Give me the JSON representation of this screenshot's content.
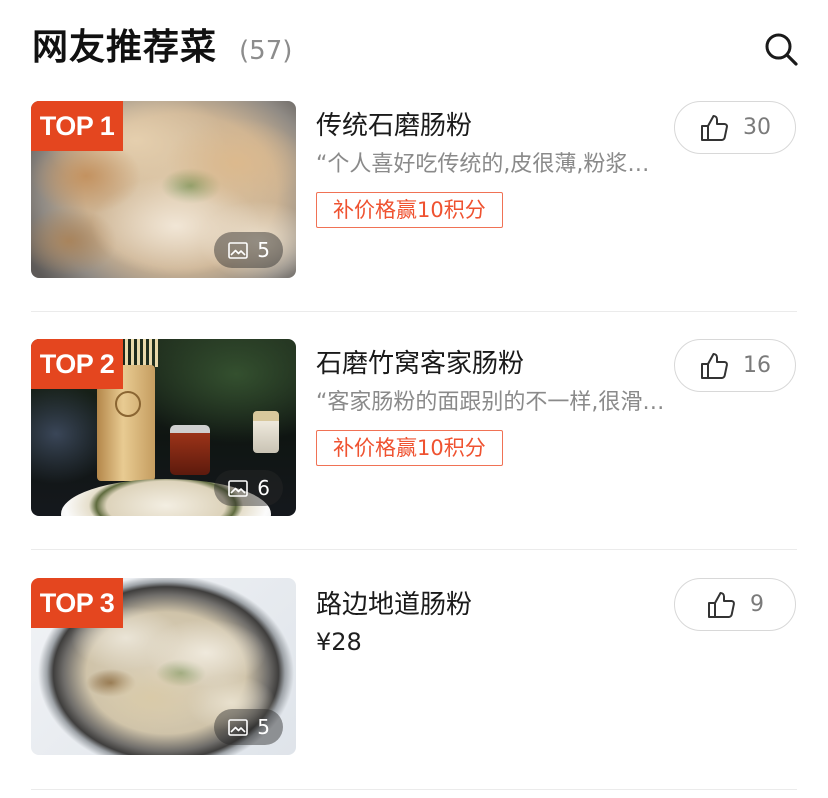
{
  "header": {
    "title": "网友推荐菜",
    "count": "(57)"
  },
  "icons": {
    "search": "search-icon",
    "like": "thumbs-up-icon",
    "photo": "image-icon"
  },
  "colors": {
    "badge": "#e4461f",
    "action": "#ef5230",
    "muted_text": "#8a8a8a",
    "divider": "#ebebeb"
  },
  "dishes": [
    {
      "rank": "TOP 1",
      "name": "传统石磨肠粉",
      "quote": "“个人喜好吃传统的,皮很薄,粉浆…",
      "action_label": "补价格赢10积分",
      "likes": 30,
      "photo_count": 5
    },
    {
      "rank": "TOP 2",
      "name": "石磨竹窝客家肠粉",
      "quote": "“客家肠粉的面跟别的不一样,很滑…",
      "action_label": "补价格赢10积分",
      "likes": 16,
      "photo_count": 6
    },
    {
      "rank": "TOP 3",
      "name": "路边地道肠粉",
      "price": "¥28",
      "likes": 9,
      "photo_count": 5
    }
  ]
}
